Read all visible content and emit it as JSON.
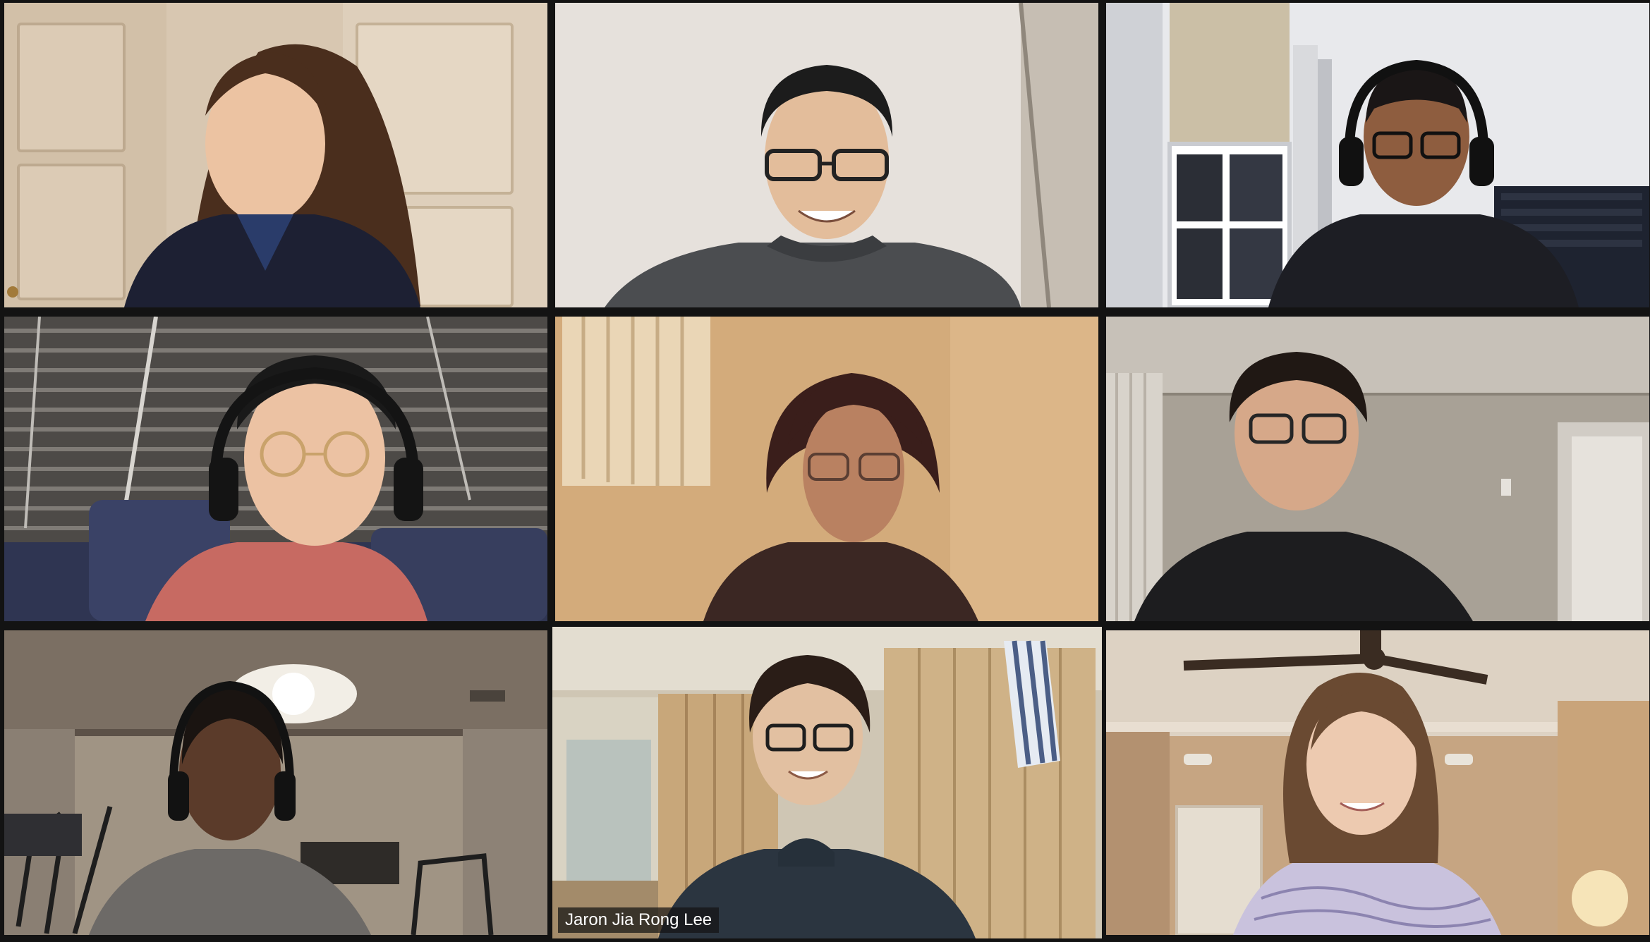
{
  "gallery_view": {
    "rows": 3,
    "columns": 3,
    "background_color": "#131313",
    "active_speaker_border_color": "#e9ec8a",
    "participants": [
      {
        "position": "row1-col1",
        "background": "beige-closet-doors",
        "name_label": ""
      },
      {
        "position": "row1-col2",
        "background": "plain-off-white-wall",
        "name_label": ""
      },
      {
        "position": "row1-col3",
        "background": "room-with-window",
        "name_label": ""
      },
      {
        "position": "row2-col1",
        "background": "window-blinds",
        "name_label": ""
      },
      {
        "position": "row2-col2",
        "background": "warm-lit-wall",
        "name_label": ""
      },
      {
        "position": "row2-col3",
        "background": "grey-room-with-curtain",
        "name_label": ""
      },
      {
        "position": "row3-col1",
        "background": "dim-room-with-ceiling-light",
        "name_label": ""
      },
      {
        "position": "row3-col2",
        "background": "wooden-room-divider",
        "name_label": "Jaron Jia Rong Lee",
        "active_speaker": true
      },
      {
        "position": "row3-col3",
        "background": "room-with-ceiling-fan",
        "name_label": ""
      }
    ]
  }
}
